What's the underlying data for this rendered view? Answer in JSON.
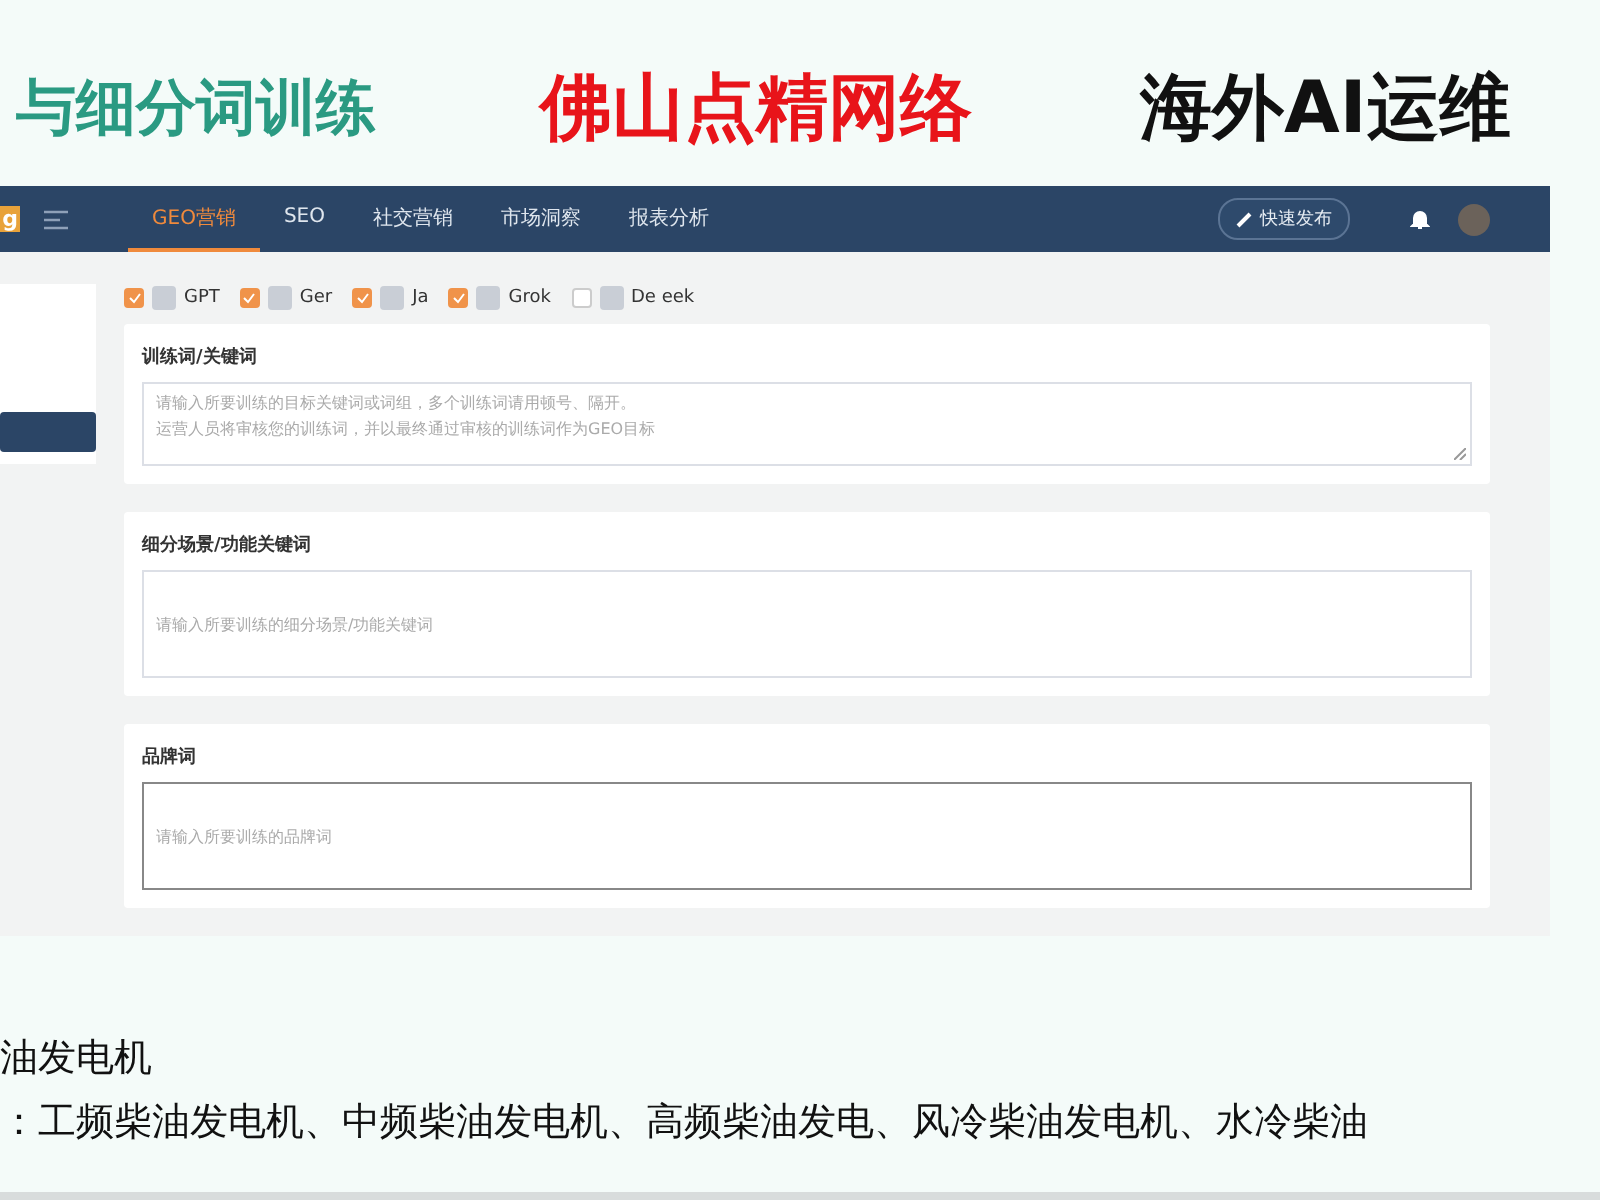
{
  "slide": {
    "title_left": "与细分词训练",
    "title_brand": "佛山点精网络",
    "title_right": "海外AI运维"
  },
  "app": {
    "logo": "g",
    "tabs": [
      {
        "label": "GEO营销",
        "selected": true
      },
      {
        "label": "SEO",
        "selected": false
      },
      {
        "label": "社交营销",
        "selected": false
      },
      {
        "label": "市场洞察",
        "selected": false
      },
      {
        "label": "报表分析",
        "selected": false
      }
    ],
    "publish_button": "快速发布",
    "models": [
      {
        "label": "GPT",
        "checked": true
      },
      {
        "label": "Ger",
        "checked": true
      },
      {
        "label": "Ja",
        "checked": true
      },
      {
        "label": "Grok",
        "checked": true
      },
      {
        "label": "De   eek",
        "checked": false
      }
    ],
    "fields": [
      {
        "label": "训练词/关键词",
        "placeholder": [
          "请输入所要训练的目标关键词或词组，多个训练词请用顿号、隔开。",
          "运营人员将审核您的训练词，并以最终通过审核的训练词作为GEO目标"
        ],
        "kind": "textarea",
        "focused": false
      },
      {
        "label": "细分场景/功能关键词",
        "placeholder": "请输入所要训练的细分场景/功能关键词",
        "kind": "input",
        "focused": false
      },
      {
        "label": "品牌词",
        "placeholder": "请输入所要训练的品牌词",
        "kind": "input",
        "focused": true
      }
    ]
  },
  "caption": {
    "line_1": "油发电机",
    "line_2": "：工频柴油发电机、中频柴油发电机、高频柴油发电、风冷柴油发电机、水冷柴油"
  }
}
